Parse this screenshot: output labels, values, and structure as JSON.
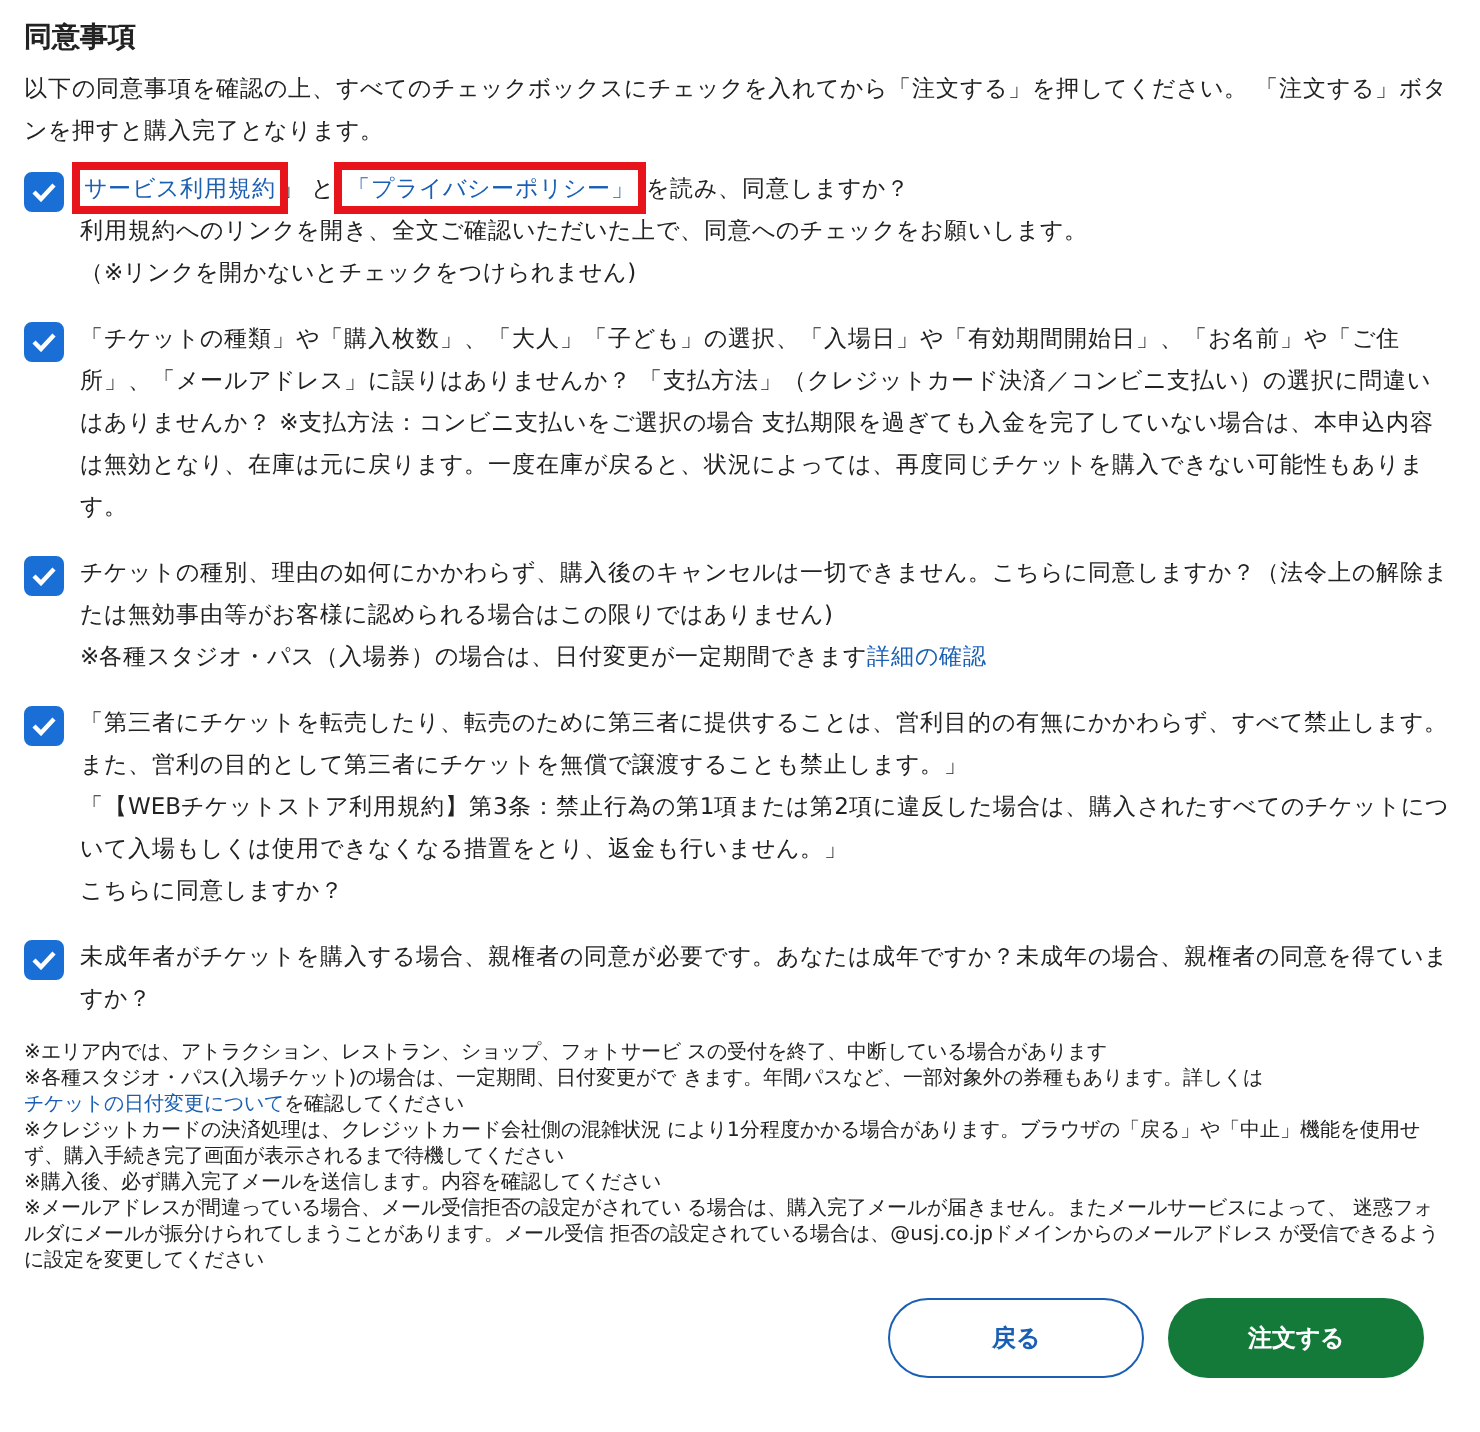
{
  "heading": "同意事項",
  "intro": "以下の同意事項を確認の上、すべてのチェックボックスにチェックを入れてから「注文する」を押してください。 「注文する」ボタンを押すと購入完了となります。",
  "items": [
    {
      "checked": true,
      "paragraphs": [
        [
          {
            "kind": "link",
            "text": "サービス利用規約",
            "highlighted": true
          },
          {
            "kind": "text",
            "text": "」 と "
          },
          {
            "kind": "link",
            "text": "「プライバシーポリシー」",
            "highlighted": true
          },
          {
            "kind": "text",
            "text": " を読み、同意しますか？"
          }
        ],
        [
          {
            "kind": "text",
            "text": "利用規約へのリンクを開き、全文ご確認いただいた上で、同意へのチェックをお願いします。"
          }
        ],
        [
          {
            "kind": "text",
            "text": "（※リンクを開かないとチェックをつけられません)"
          }
        ]
      ]
    },
    {
      "checked": true,
      "paragraphs": [
        [
          {
            "kind": "text",
            "text": "「チケットの種類」や「購入枚数」、「大人」「子ども」の選択、「入場日」や「有効期間開始日」、「お名前」や「ご住所」、「メールアドレス」に誤りはありませんか？ 「支払方法」（クレジットカード決済／コンビニ支払い）の選択に問違いはありませんか？ ※支払方法：コンビニ支払いをご選択の場合 支払期限を過ぎても入金を完了していない場合は、本申込内容は無効となり、在庫は元に戻ります。一度在庫が戻ると、状況によっては、再度同じチケットを購入できない可能性もあります。"
          }
        ]
      ]
    },
    {
      "checked": true,
      "paragraphs": [
        [
          {
            "kind": "text",
            "text": "チケットの種別、理由の如何にかかわらず、購入後のキャンセルは一切できません。こちらに同意しますか？（法令上の解除または無効事由等がお客様に認められる場合はこの限りではありません)"
          }
        ],
        [
          {
            "kind": "text",
            "text": "※各種スタジオ・パス（入場券）の場合は、日付変更が一定期間できます"
          },
          {
            "kind": "link",
            "text": "詳細の確認",
            "highlighted": false
          }
        ]
      ]
    },
    {
      "checked": true,
      "paragraphs": [
        [
          {
            "kind": "text",
            "text": "「第三者にチケットを転売したり、転売のために第三者に提供することは、営利目的の有無にかかわらず、すべて禁止します。また、営利の目的として第三者にチケットを無償で譲渡することも禁止します。」"
          }
        ],
        [
          {
            "kind": "text",
            "text": "「【WEBチケットストア利用規約】第3条：禁止行為の第1項または第2項に違反した場合は、購入されたすべてのチケットについて入場もしくは使用できなくなる措置をとり、返金も行いません。」"
          }
        ],
        [
          {
            "kind": "text",
            "text": "こちらに同意しますか？"
          }
        ]
      ]
    },
    {
      "checked": true,
      "paragraphs": [
        [
          {
            "kind": "text",
            "text": "未成年者がチケットを購入する場合、親権者の同意が必要です。あなたは成年ですか？未成年の場合、親権者の同意を得ていますか？"
          }
        ]
      ]
    }
  ],
  "notes": [
    [
      {
        "kind": "text",
        "text": "※エリア内では、アトラクション、レストラン、ショップ、フォトサービ スの受付を終了、中断している場合があります"
      }
    ],
    [
      {
        "kind": "text",
        "text": "※各種スタジオ・パス(入場チケット)の場合は、一定期間、日付変更がで きます。年間パスなど、一部対象外の券種もあります。詳しくは"
      },
      {
        "kind": "link",
        "text": "チケットの日付変更について",
        "highlighted": false
      },
      {
        "kind": "text",
        "text": "を確認してください"
      }
    ],
    [
      {
        "kind": "text",
        "text": "※クレジットカードの決済処理は、クレジットカード会社側の混雑状況 により1分程度かかる場合があります。ブラウザの「戻る」や「中止」機能を使用せず、購入手続き完了画面が表示されるまで待機してください"
      }
    ],
    [
      {
        "kind": "text",
        "text": "※購入後、必ず購入完了メールを送信します。内容を確認してください"
      }
    ],
    [
      {
        "kind": "text",
        "text": "※メールアドレスが間違っている場合、メール受信拒否の設定がされてい る場合は、購入完了メールが届きません。またメールサービスによって、 迷惑フォルダにメールが振分けられてしまうことがあります。メール受信 拒否の設定されている場合は、@usj.co.jpドメインからのメールアドレス が受信できるように設定を変更してください"
      }
    ]
  ],
  "buttons": [
    {
      "label": "戻る",
      "kind": "secondary"
    },
    {
      "label": "注文する",
      "kind": "primary"
    }
  ]
}
